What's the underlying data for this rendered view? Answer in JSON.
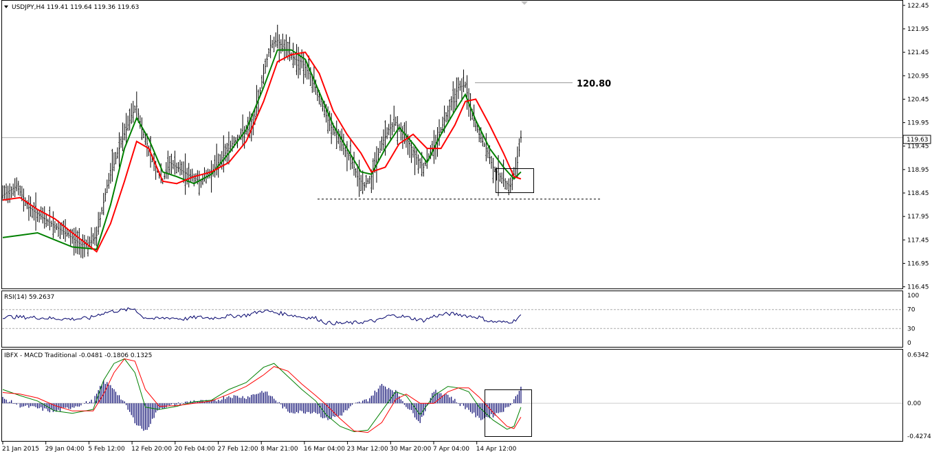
{
  "main_panel": {
    "symbol_info": "USDJPY,H4  119.41 119.64 119.36 119.63",
    "current_price_label": "119.63",
    "resistance_label": "120.80"
  },
  "rsi_panel": {
    "title": "RSI(14) 59.2637"
  },
  "macd_panel": {
    "title": "IBFX - MACD Traditional -0.0481 -0.1806 0.1325"
  },
  "colors": {
    "bars": "#000000",
    "fast_line": "#008000",
    "slow_line": "#ff0000",
    "rsi_line": "#00006b",
    "histogram": "#00006b",
    "level_line": "#999999"
  },
  "chart_data": [
    {
      "panel": "price",
      "type": "ohlc_bars_with_moving_averages",
      "y_ticks": [
        "122.45",
        "121.95",
        "121.45",
        "120.95",
        "120.45",
        "119.95",
        "119.45",
        "118.95",
        "118.45",
        "117.95",
        "117.45",
        "116.95",
        "116.45"
      ],
      "x_ticks": [
        "21 Jan 2015",
        "29 Jan 04:00",
        "5 Feb 12:00",
        "12 Feb 20:00",
        "20 Feb 04:00",
        "27 Feb 12:00",
        "8 Mar 21:00",
        "16 Mar 04:00",
        "23 Mar 12:00",
        "30 Mar 20:00",
        "7 Apr 04:00",
        "14 Apr 12:00"
      ],
      "ylim": [
        116.4,
        122.55
      ],
      "last_close": 119.63,
      "resistance": 120.8,
      "support": 118.32,
      "close_path": [
        [
          0,
          118.4
        ],
        [
          8,
          118.6
        ],
        [
          15,
          118.15
        ],
        [
          22,
          117.95
        ],
        [
          30,
          117.75
        ],
        [
          38,
          117.55
        ],
        [
          45,
          117.35
        ],
        [
          51,
          117.4
        ],
        [
          54,
          117.55
        ],
        [
          60,
          118.6
        ],
        [
          66,
          119.3
        ],
        [
          70,
          119.7
        ],
        [
          74,
          120.1
        ],
        [
          77,
          120.3
        ],
        [
          80,
          119.8
        ],
        [
          84,
          119.4
        ],
        [
          88,
          119.0
        ],
        [
          92,
          118.7
        ],
        [
          96,
          119.1
        ],
        [
          100,
          119.0
        ],
        [
          104,
          118.9
        ],
        [
          108,
          118.8
        ],
        [
          114,
          118.7
        ],
        [
          120,
          118.9
        ],
        [
          126,
          119.2
        ],
        [
          132,
          119.5
        ],
        [
          138,
          119.7
        ],
        [
          144,
          119.9
        ],
        [
          150,
          121.0
        ],
        [
          154,
          121.6
        ],
        [
          158,
          121.7
        ],
        [
          163,
          121.5
        ],
        [
          168,
          121.3
        ],
        [
          172,
          121.25
        ],
        [
          176,
          121.0
        ],
        [
          180,
          120.7
        ],
        [
          184,
          120.3
        ],
        [
          188,
          119.9
        ],
        [
          192,
          119.7
        ],
        [
          196,
          119.4
        ],
        [
          200,
          119.2
        ],
        [
          204,
          118.8
        ],
        [
          208,
          118.6
        ],
        [
          212,
          118.8
        ],
        [
          218,
          119.5
        ],
        [
          222,
          119.8
        ],
        [
          226,
          119.95
        ],
        [
          230,
          119.7
        ],
        [
          234,
          119.5
        ],
        [
          238,
          119.2
        ],
        [
          242,
          119.0
        ],
        [
          246,
          119.3
        ],
        [
          250,
          119.6
        ],
        [
          254,
          120.0
        ],
        [
          258,
          120.4
        ],
        [
          262,
          120.7
        ],
        [
          266,
          120.75
        ],
        [
          270,
          120.1
        ],
        [
          274,
          119.7
        ],
        [
          278,
          119.4
        ],
        [
          282,
          119.0
        ],
        [
          286,
          118.8
        ],
        [
          290,
          118.65
        ],
        [
          292,
          118.6
        ],
        [
          296,
          119.1
        ],
        [
          298,
          119.63
        ]
      ],
      "series": [
        {
          "name": "fast",
          "color": "#008000",
          "values": [
            [
              0,
              117.5
            ],
            [
              10,
              117.55
            ],
            [
              20,
              117.6
            ],
            [
              30,
              117.45
            ],
            [
              40,
              117.3
            ],
            [
              54,
              117.25
            ],
            [
              62,
              118.2
            ],
            [
              70,
              119.4
            ],
            [
              77,
              120.05
            ],
            [
              84,
              119.6
            ],
            [
              92,
              118.9
            ],
            [
              100,
              118.8
            ],
            [
              110,
              118.65
            ],
            [
              120,
              118.85
            ],
            [
              130,
              119.3
            ],
            [
              140,
              119.8
            ],
            [
              150,
              120.7
            ],
            [
              158,
              121.5
            ],
            [
              166,
              121.5
            ],
            [
              174,
              121.3
            ],
            [
              182,
              120.6
            ],
            [
              190,
              119.9
            ],
            [
              198,
              119.4
            ],
            [
              206,
              118.9
            ],
            [
              212,
              118.85
            ],
            [
              220,
              119.4
            ],
            [
              228,
              119.85
            ],
            [
              236,
              119.5
            ],
            [
              244,
              119.1
            ],
            [
              252,
              119.7
            ],
            [
              260,
              120.2
            ],
            [
              266,
              120.55
            ],
            [
              272,
              120.0
            ],
            [
              280,
              119.4
            ],
            [
              288,
              119.0
            ],
            [
              294,
              118.75
            ],
            [
              298,
              118.9
            ]
          ]
        },
        {
          "name": "slow",
          "color": "#ff0000",
          "values": [
            [
              0,
              118.3
            ],
            [
              10,
              118.35
            ],
            [
              20,
              118.1
            ],
            [
              30,
              117.9
            ],
            [
              40,
              117.6
            ],
            [
              54,
              117.2
            ],
            [
              62,
              117.8
            ],
            [
              70,
              118.7
            ],
            [
              77,
              119.55
            ],
            [
              84,
              119.4
            ],
            [
              92,
              118.7
            ],
            [
              100,
              118.65
            ],
            [
              110,
              118.8
            ],
            [
              120,
              118.9
            ],
            [
              130,
              119.1
            ],
            [
              140,
              119.55
            ],
            [
              150,
              120.4
            ],
            [
              158,
              121.25
            ],
            [
              166,
              121.4
            ],
            [
              174,
              121.45
            ],
            [
              182,
              121.0
            ],
            [
              190,
              120.2
            ],
            [
              198,
              119.7
            ],
            [
              206,
              119.3
            ],
            [
              212,
              118.9
            ],
            [
              220,
              119.0
            ],
            [
              228,
              119.5
            ],
            [
              236,
              119.7
            ],
            [
              244,
              119.4
            ],
            [
              252,
              119.4
            ],
            [
              260,
              119.9
            ],
            [
              266,
              120.4
            ],
            [
              272,
              120.45
            ],
            [
              280,
              119.9
            ],
            [
              288,
              119.3
            ],
            [
              294,
              118.8
            ],
            [
              298,
              118.75
            ]
          ]
        }
      ]
    },
    {
      "panel": "rsi",
      "type": "line",
      "y_ticks": [
        "100",
        "70",
        "30",
        "0"
      ],
      "ylim": [
        0,
        100
      ],
      "levels": [
        70,
        30
      ],
      "last_value": 59.2637,
      "series": [
        {
          "name": "RSI(14)",
          "color": "#00006b",
          "values": [
            [
              0,
              55
            ],
            [
              10,
              54
            ],
            [
              20,
              53
            ],
            [
              30,
              51
            ],
            [
              40,
              50
            ],
            [
              50,
              52
            ],
            [
              56,
              61
            ],
            [
              62,
              66
            ],
            [
              70,
              69
            ],
            [
              76,
              72
            ],
            [
              80,
              55
            ],
            [
              88,
              50
            ],
            [
              96,
              53
            ],
            [
              104,
              50
            ],
            [
              112,
              54
            ],
            [
              120,
              52
            ],
            [
              130,
              56
            ],
            [
              140,
              58
            ],
            [
              150,
              68
            ],
            [
              156,
              64
            ],
            [
              164,
              60
            ],
            [
              172,
              54
            ],
            [
              180,
              52
            ],
            [
              186,
              42
            ],
            [
              194,
              41
            ],
            [
              202,
              42
            ],
            [
              210,
              45
            ],
            [
              216,
              47
            ],
            [
              222,
              57
            ],
            [
              228,
              57
            ],
            [
              236,
              51
            ],
            [
              242,
              47
            ],
            [
              248,
              56
            ],
            [
              256,
              61
            ],
            [
              262,
              60
            ],
            [
              268,
              56
            ],
            [
              274,
              54
            ],
            [
              280,
              45
            ],
            [
              288,
              43
            ],
            [
              294,
              46
            ],
            [
              298,
              59
            ]
          ]
        }
      ]
    },
    {
      "panel": "macd",
      "type": "line_and_histogram",
      "y_ticks": [
        "0.6342",
        "0.00",
        "-0.4274"
      ],
      "ylim": [
        -0.5,
        0.7
      ],
      "values_in_title": [
        -0.0481,
        -0.1806,
        0.1325
      ],
      "series": [
        {
          "name": "MACD",
          "color": "#008000",
          "values": [
            [
              0,
              0.18
            ],
            [
              10,
              0.1
            ],
            [
              20,
              0.03
            ],
            [
              30,
              -0.1
            ],
            [
              40,
              -0.13
            ],
            [
              52,
              -0.08
            ],
            [
              58,
              0.3
            ],
            [
              64,
              0.52
            ],
            [
              70,
              0.58
            ],
            [
              76,
              0.4
            ],
            [
              82,
              -0.05
            ],
            [
              90,
              -0.08
            ],
            [
              100,
              -0.04
            ],
            [
              110,
              0.02
            ],
            [
              120,
              0.04
            ],
            [
              130,
              0.18
            ],
            [
              140,
              0.27
            ],
            [
              150,
              0.47
            ],
            [
              156,
              0.52
            ],
            [
              164,
              0.35
            ],
            [
              172,
              0.18
            ],
            [
              180,
              0.03
            ],
            [
              186,
              -0.15
            ],
            [
              194,
              -0.3
            ],
            [
              202,
              -0.37
            ],
            [
              210,
              -0.35
            ],
            [
              218,
              -0.1
            ],
            [
              226,
              0.15
            ],
            [
              232,
              0.1
            ],
            [
              240,
              -0.15
            ],
            [
              248,
              0.1
            ],
            [
              256,
              0.22
            ],
            [
              262,
              0.2
            ],
            [
              268,
              0.15
            ],
            [
              274,
              -0.05
            ],
            [
              282,
              -0.22
            ],
            [
              290,
              -0.34
            ],
            [
              294,
              -0.3
            ],
            [
              298,
              -0.05
            ]
          ]
        },
        {
          "name": "Signal",
          "color": "#ff0000",
          "values": [
            [
              0,
              0.14
            ],
            [
              10,
              0.12
            ],
            [
              20,
              0.07
            ],
            [
              30,
              -0.03
            ],
            [
              40,
              -0.1
            ],
            [
              52,
              -0.1
            ],
            [
              58,
              0.12
            ],
            [
              64,
              0.4
            ],
            [
              70,
              0.58
            ],
            [
              76,
              0.55
            ],
            [
              82,
              0.18
            ],
            [
              90,
              -0.04
            ],
            [
              100,
              -0.03
            ],
            [
              110,
              0.0
            ],
            [
              120,
              0.03
            ],
            [
              130,
              0.12
            ],
            [
              140,
              0.22
            ],
            [
              150,
              0.37
            ],
            [
              156,
              0.48
            ],
            [
              164,
              0.42
            ],
            [
              172,
              0.25
            ],
            [
              180,
              0.1
            ],
            [
              186,
              -0.02
            ],
            [
              194,
              -0.2
            ],
            [
              202,
              -0.36
            ],
            [
              210,
              -0.38
            ],
            [
              218,
              -0.25
            ],
            [
              226,
              0.05
            ],
            [
              232,
              0.12
            ],
            [
              240,
              0.0
            ],
            [
              248,
              0.0
            ],
            [
              256,
              0.15
            ],
            [
              262,
              0.2
            ],
            [
              268,
              0.2
            ],
            [
              274,
              0.08
            ],
            [
              282,
              -0.12
            ],
            [
              290,
              -0.3
            ],
            [
              294,
              -0.33
            ],
            [
              298,
              -0.18
            ]
          ]
        }
      ],
      "histogram_note": "bars follow MACD minus Signal"
    }
  ]
}
